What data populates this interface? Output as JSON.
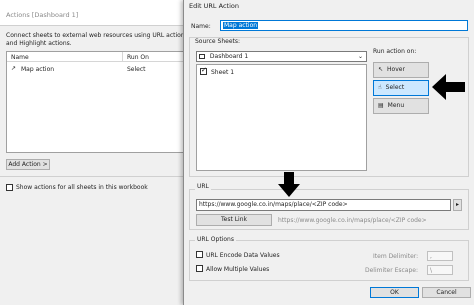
{
  "actions_dialog": {
    "title": "Actions [Dashboard 1]",
    "description_line1": "Connect sheets to external web resources using URL actions, or",
    "description_line2": "and Highlight actions.",
    "columns": [
      "Name",
      "Run On"
    ],
    "row": {
      "name": "Map action",
      "run_on": "Select"
    },
    "add_action_label": "Add Action >",
    "show_all_label": "Show actions for all sheets in this workbook"
  },
  "edit_dialog": {
    "title": "Edit URL Action",
    "name_label": "Name:",
    "name_value": "Map action",
    "source_sheets_label": "Source Sheets:",
    "dashboard_select": "Dashboard 1",
    "sheet_item": "Sheet 1",
    "run_action_label": "Run action on:",
    "run_buttons": [
      "Hover",
      "Select",
      "Menu"
    ],
    "url_section_label": "URL",
    "url_value": "https://www.google.co.in/maps/place/<ZIP code>",
    "test_link_label": "Test Link",
    "test_link_preview": "https://www.google.co.in/maps/place/<ZIP code>",
    "url_options_label": "URL Options",
    "option_encode": "URL Encode Data Values",
    "option_multiple": "Allow Multiple Values",
    "item_delimiter_label": "Item Delimiter:",
    "item_delimiter_value": ",",
    "delimiter_escape_label": "Delimiter Escape:",
    "delimiter_escape_value": "\\",
    "ok_label": "OK",
    "cancel_label": "Cancel"
  },
  "colors": {
    "selection": "#cce8ff",
    "accent": "#0078d7",
    "arrow": "#000000"
  }
}
